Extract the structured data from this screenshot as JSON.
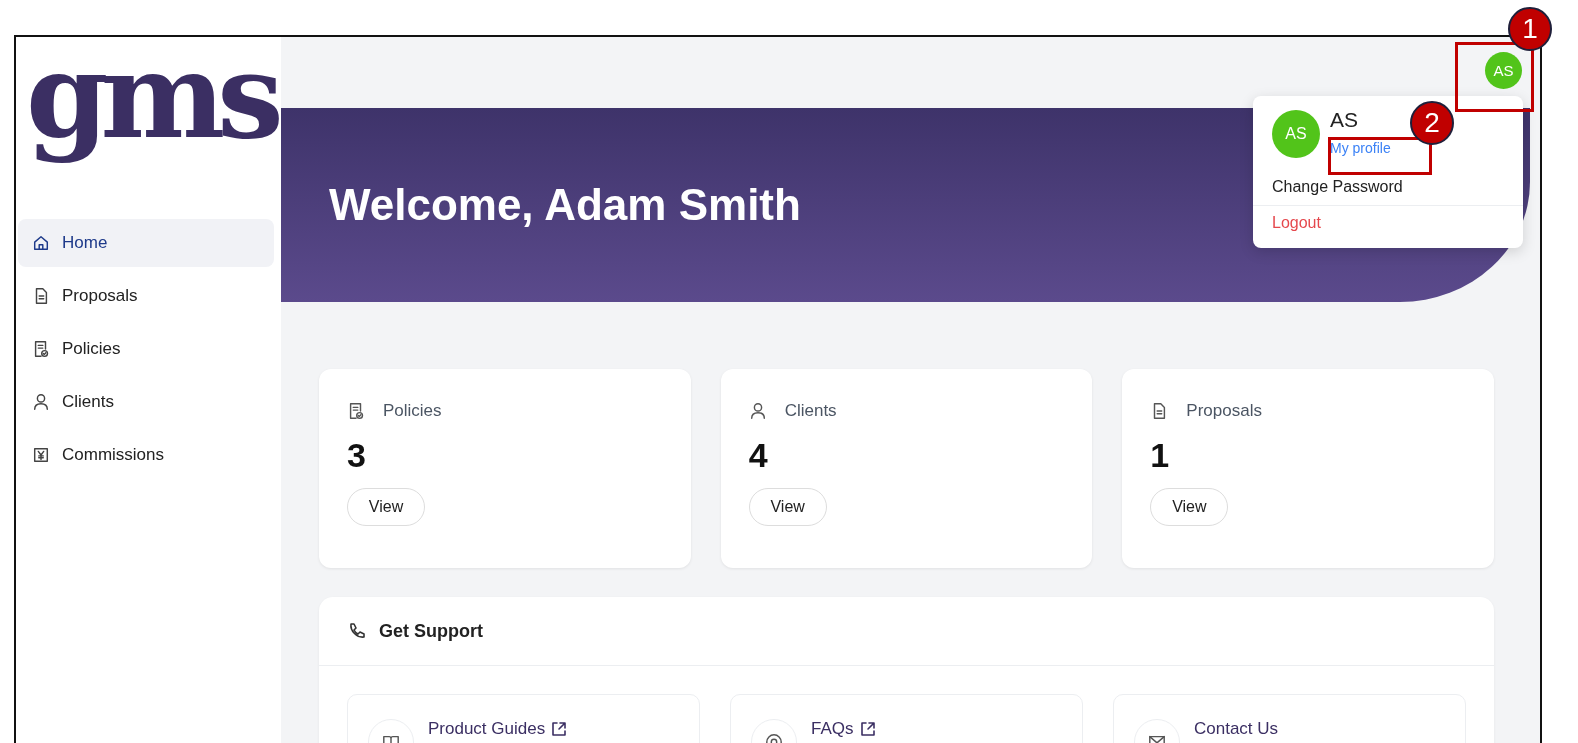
{
  "logo": "gms",
  "sidebar": {
    "items": [
      {
        "label": "Home",
        "selected": true
      },
      {
        "label": "Proposals",
        "selected": false
      },
      {
        "label": "Policies",
        "selected": false
      },
      {
        "label": "Clients",
        "selected": false
      },
      {
        "label": "Commissions",
        "selected": false
      }
    ]
  },
  "header": {
    "avatar": "AS"
  },
  "banner": {
    "title": "Welcome, Adam Smith"
  },
  "profile_menu": {
    "avatar": "AS",
    "name": "AS",
    "profile_link": "My profile",
    "items": [
      {
        "label": "Change Password",
        "kind": "plain"
      },
      {
        "label": "Logout",
        "kind": "danger"
      }
    ]
  },
  "stats": [
    {
      "label": "Policies",
      "value": "3",
      "button": "View"
    },
    {
      "label": "Clients",
      "value": "4",
      "button": "View"
    },
    {
      "label": "Proposals",
      "value": "1",
      "button": "View"
    }
  ],
  "support": {
    "title": "Get Support",
    "items": [
      {
        "title": "Product Guides",
        "external": true
      },
      {
        "title": "FAQs",
        "external": true
      },
      {
        "title": "Contact Us",
        "external": false
      }
    ]
  },
  "callouts": [
    {
      "number": "1"
    },
    {
      "number": "2"
    }
  ]
}
